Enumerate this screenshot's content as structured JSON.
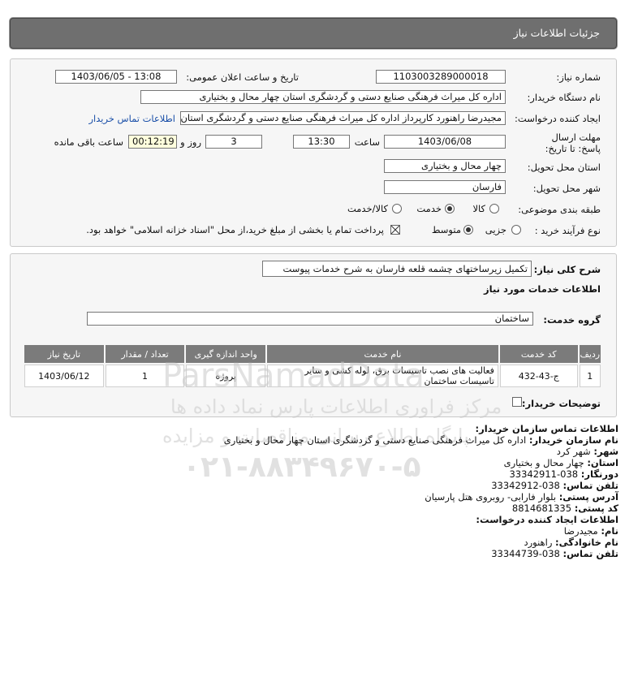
{
  "header": {
    "title": "جزئیات اطلاعات نیاز"
  },
  "form": {
    "need_number": {
      "label": "شماره نیاز:",
      "value": "1103003289000018"
    },
    "announce": {
      "label": "تاریخ و ساعت اعلان عمومی:",
      "value": "1403/06/05 - 13:08"
    },
    "buyer_org": {
      "label": "نام دستگاه خریدار:",
      "value": "اداره کل میراث فرهنگی  صنایع دستی و گردشگری استان چهار محال و بختیاری"
    },
    "creator": {
      "label": "ایجاد کننده درخواست:",
      "value": "مجیدرضا راهنورد کارپرداز اداره کل میراث فرهنگی  صنایع دستی و گردشگری استان",
      "contact_link": "اطلاعات تماس خریدار"
    },
    "deadline": {
      "label": "مهلت ارسال پاسخ: تا تاریخ:",
      "date": "1403/06/08",
      "time_label": "ساعت",
      "time": "13:30",
      "days": "3",
      "days_label": "روز و",
      "remaining": "00:12:19",
      "remaining_label": "ساعت باقی مانده"
    },
    "province": {
      "label": "استان محل تحویل:",
      "value": "چهار محال و بختیاری"
    },
    "city": {
      "label": "شهر محل تحویل:",
      "value": "فارسان"
    },
    "category": {
      "label": "طبقه بندی موضوعی:",
      "options": [
        "کالا",
        "خدمت",
        "کالا/خدمت"
      ],
      "selected": "خدمت"
    },
    "process": {
      "label": "نوع فرآیند خرید :",
      "options": [
        "جزیی",
        "متوسط"
      ],
      "selected": "متوسط",
      "note": "پرداخت تمام یا بخشی از مبلغ خرید،از محل \"اسناد خزانه اسلامی\" خواهد بود."
    }
  },
  "summary": {
    "label": "شرح کلی نیاز:",
    "value": "تکمیل زیرساختهای چشمه قلعه فارسان به شرح خدمات پیوست",
    "services_title": "اطلاعات خدمات مورد نیاز",
    "group_label": "گروه خدمت:",
    "group_value": "ساختمان"
  },
  "table": {
    "headers": [
      "ردیف",
      "کد خدمت",
      "نام خدمت",
      "واحد اندازه گیری",
      "تعداد / مقدار",
      "تاریخ نیاز"
    ],
    "rows": [
      [
        "1",
        "ج-43-432",
        "فعالیت های نصب تاسیسات برق، لوله کشی و سایر تاسیسات ساختمان",
        "پروژه",
        "1",
        "1403/06/12"
      ]
    ]
  },
  "buyer_notes": {
    "label": "توضیحات خریدار:"
  },
  "contact": {
    "title": "اطلاعات تماس سازمان خریدار:",
    "org_label": "نام سازمان خریدار:",
    "org": "اداره کل میراث فرهنگی صنایع دستی و گردشگری استان چهار محال و بختیاری",
    "city_label": "شهر:",
    "city": "شهر کرد",
    "province_label": "استان:",
    "province": "چهار محال و بختیاری",
    "fax_label": "دورنگار:",
    "fax": "038-33342911",
    "phone_label": "تلفن تماس:",
    "phone": "038-33342912",
    "address_label": "آدرس پستی:",
    "address": "بلوار فارابی- روبروی هتل پارسیان",
    "postal_label": "کد پستی:",
    "postal": "8814681335",
    "creator_title": "اطلاعات ایجاد کننده درخواست:",
    "name_label": "نام:",
    "name": "مجیدرضا",
    "family_label": "نام خانوادگی:",
    "family": "راهنورد",
    "creator_phone_label": "تلفن تماس:",
    "creator_phone": "038-33344739"
  },
  "watermark": {
    "site": "ParsNamadData",
    "line1": "مرکز فراوری اطلاعات پارس نماد داده ها",
    "line2": "پایگاه اطلاع رسانی مناقصات و مزایده",
    "phone": "۰۲۱-۸۸۳۴۹۶۷۰-۵"
  }
}
